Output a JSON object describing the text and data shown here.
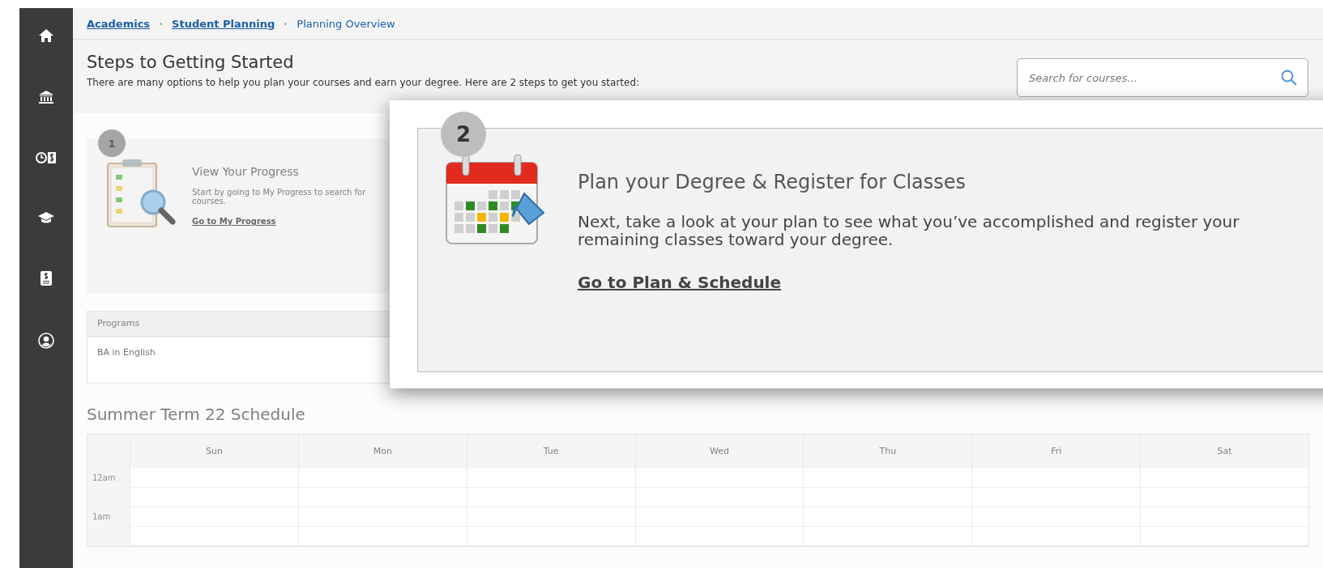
{
  "breadcrumb": [
    {
      "label": "Academics",
      "current": false
    },
    {
      "label": "Student Planning",
      "current": false
    },
    {
      "label": "Planning Overview",
      "current": true
    }
  ],
  "header": {
    "title": "Steps to Getting Started",
    "subtitle": "There are many options to help you plan your courses and earn your degree. Here are 2 steps to get you started:"
  },
  "search": {
    "placeholder": "Search for courses..."
  },
  "steps": [
    {
      "number": "1",
      "title": "View Your Progress",
      "text": "Start by going to My Progress to search for courses.",
      "link": "Go to My Progress"
    }
  ],
  "programs": {
    "heading": "Programs",
    "rows": [
      "BA in English"
    ]
  },
  "schedule": {
    "title": "Summer Term 22 Schedule",
    "days": [
      "Sun",
      "Mon",
      "Tue",
      "Wed",
      "Thu",
      "Fri",
      "Sat"
    ],
    "times": [
      "12am",
      "1am"
    ]
  },
  "popup": {
    "number": "2",
    "title": "Plan your Degree & Register for Classes",
    "text": "Next, take a look at your plan to see what you’ve accomplished and register your remaining classes toward your degree.",
    "link": "Go to Plan & Schedule"
  }
}
